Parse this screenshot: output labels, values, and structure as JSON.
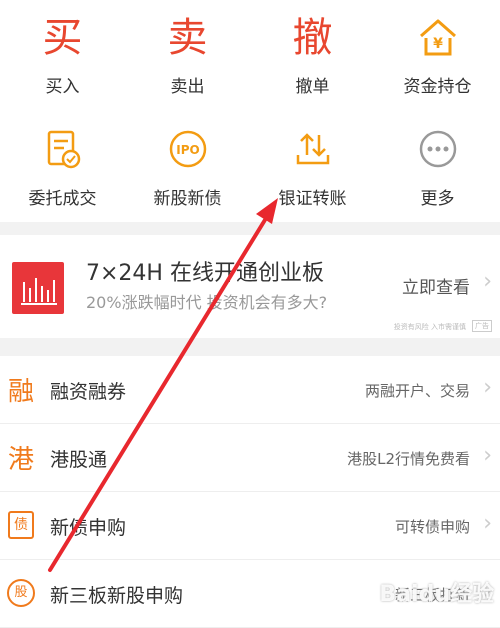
{
  "grid": {
    "row1": [
      {
        "glyph": "买",
        "label": "买入"
      },
      {
        "glyph": "卖",
        "label": "卖出"
      },
      {
        "glyph": "撤",
        "label": "撤单"
      },
      {
        "label": "资金持仓",
        "icon": "yuan-house-icon"
      }
    ],
    "row2": [
      {
        "label": "委托成交",
        "icon": "document-check-icon"
      },
      {
        "label": "新股新债",
        "icon": "ipo-icon",
        "icon_text": "IPO"
      },
      {
        "label": "银证转账",
        "icon": "transfer-arrows-icon"
      },
      {
        "label": "更多",
        "icon": "more-dots-icon"
      }
    ]
  },
  "banner": {
    "title": "7×24H 在线开通创业板",
    "subtitle": "20%涨跌幅时代 投资机会有多大?",
    "cta": "立即查看",
    "risk": "投资有风险 入市需谨慎",
    "ad": "广告"
  },
  "list": [
    {
      "icon_char": "融",
      "label": "融资融券",
      "right": "两融开户、交易"
    },
    {
      "icon_char": "港",
      "label": "港股通",
      "right": "港股L2行情免费看"
    },
    {
      "icon_char": "债",
      "label": "新债申购",
      "right": "可转债申购"
    },
    {
      "icon_char": "股",
      "label": "新三板新股申购",
      "right": "新三板打新"
    }
  ],
  "watermark": "Baidu经验",
  "colors": {
    "accent": "#e8472f",
    "orange": "#f39c12",
    "banner": "#e8363a",
    "list_icon": "#f07a1c"
  }
}
